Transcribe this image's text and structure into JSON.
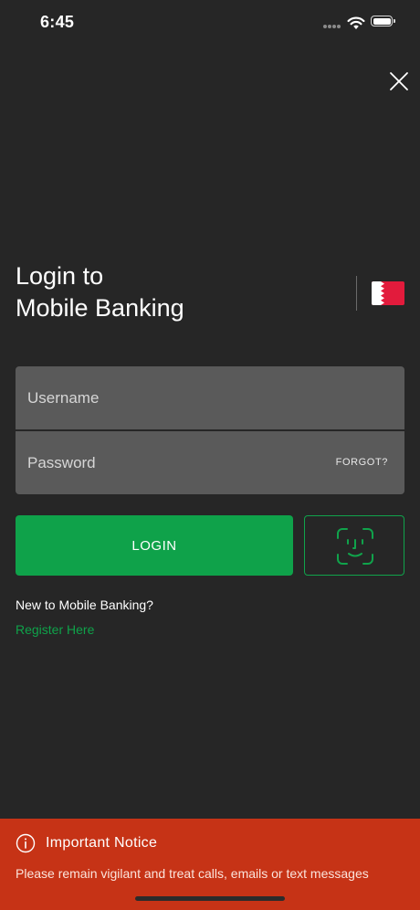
{
  "status_bar": {
    "time": "6:45"
  },
  "header": {
    "close_icon": "close-icon"
  },
  "login": {
    "title_line1": "Login to",
    "title_line2": "Mobile Banking",
    "flag_icon": "bahrain-flag-icon",
    "username_placeholder": "Username",
    "password_placeholder": "Password",
    "forgot_label": "FORGOT?",
    "login_label": "LOGIN",
    "faceid_icon": "face-id-icon",
    "register_prompt": "New to Mobile Banking?",
    "register_link": "Register Here"
  },
  "notice": {
    "icon": "info-icon",
    "title": "Important Notice",
    "text": "Please remain vigilant and treat calls, emails or text messages"
  },
  "colors": {
    "background": "#262626",
    "field": "#5a5a5a",
    "accent_green": "#0fa24a",
    "notice_red": "#c63316",
    "flag_red": "#e21b3c"
  }
}
